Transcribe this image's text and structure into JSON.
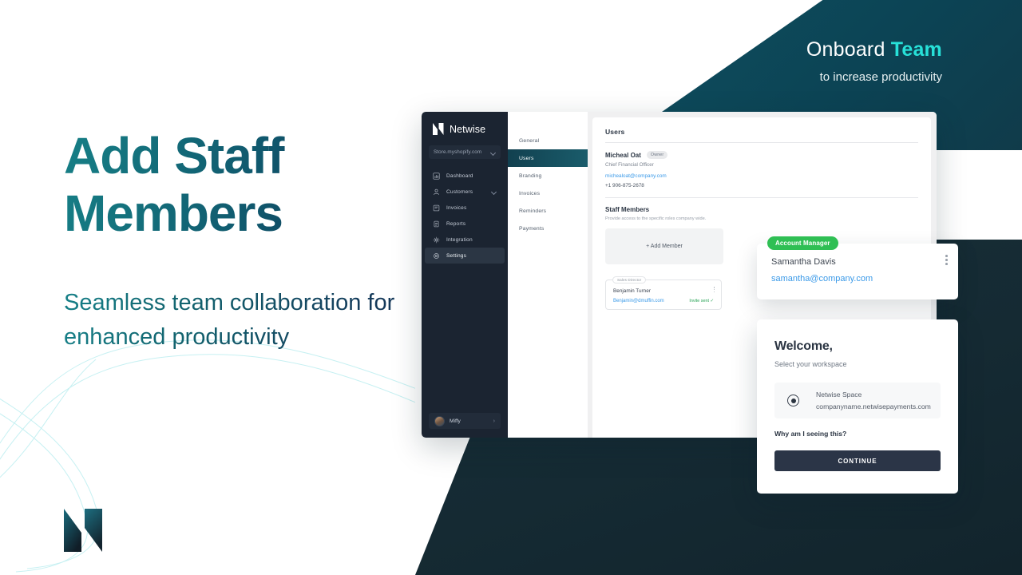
{
  "hero": {
    "headline_line1": "Add Staff",
    "headline_line2": "Members",
    "subhead": "Seamless team collaboration for enhanced productivity",
    "logo_icon": "netwise-n-logo"
  },
  "top_right": {
    "title_primary": "Onboard",
    "title_accent": "Team",
    "subtitle": "to increase productivity"
  },
  "app": {
    "sidebar": {
      "logo_text": "Netwise",
      "logo_icon": "netwise-n-logo",
      "store_select": {
        "value": "Store.myshopify.com",
        "chevron_icon": "chevron-down-icon"
      },
      "nav": [
        {
          "label": "Dashboard",
          "icon": "chart-bar-icon",
          "active": false,
          "has_chevron": false
        },
        {
          "label": "Customers",
          "icon": "user-icon",
          "active": false,
          "has_chevron": true
        },
        {
          "label": "Invoices",
          "icon": "invoice-icon",
          "active": false,
          "has_chevron": false
        },
        {
          "label": "Reports",
          "icon": "report-icon",
          "active": false,
          "has_chevron": false
        },
        {
          "label": "Integration",
          "icon": "integration-icon",
          "active": false,
          "has_chevron": false
        },
        {
          "label": "Settings",
          "icon": "gear-icon",
          "active": true,
          "has_chevron": false
        }
      ],
      "footer": {
        "name": "Miffy",
        "avatar_icon": "avatar",
        "arrow_icon": "chevron-right-icon"
      }
    },
    "subnav": [
      {
        "label": "General",
        "active": false
      },
      {
        "label": "Users",
        "active": true
      },
      {
        "label": "Branding",
        "active": false
      },
      {
        "label": "Invoices",
        "active": false
      },
      {
        "label": "Reminders",
        "active": false
      },
      {
        "label": "Payments",
        "active": false
      }
    ],
    "main": {
      "title": "Users",
      "owner": {
        "name": "Micheal Oat",
        "badge": "Owner",
        "role": "Chief Financial Officer",
        "email": "michealoat@company.com",
        "phone": "+1 906-875-2678"
      },
      "staff_section": {
        "title": "Staff Members",
        "description": "Provide access to the specific roles company wide.",
        "add_member_label": "+ Add Member"
      },
      "member_card": {
        "role_chip": "Sales Director",
        "name": "Benjamin Turner",
        "email": "Benjamin@dmuffin.com",
        "status": "Invite sent ✓",
        "menu_icon": "kebab-menu-icon"
      }
    }
  },
  "samantha_card": {
    "pill_label": "Account Manager",
    "name": "Samantha Davis",
    "email": "samantha@company.com",
    "menu_icon": "kebab-menu-icon"
  },
  "welcome_modal": {
    "title": "Welcome,",
    "subtitle": "Select your workspace",
    "workspace": {
      "name": "Netwise Space",
      "url": "companyname.netwisepayments.com",
      "selected": true
    },
    "why_link": "Why am I seeing this?",
    "continue_label": "CONTINUE"
  },
  "colors": {
    "accent_cyan": "#27e0d8",
    "teal": "#0e4f60",
    "navy": "#172f38",
    "link_blue": "#3b9ae8",
    "success_green": "#2fbf54"
  }
}
